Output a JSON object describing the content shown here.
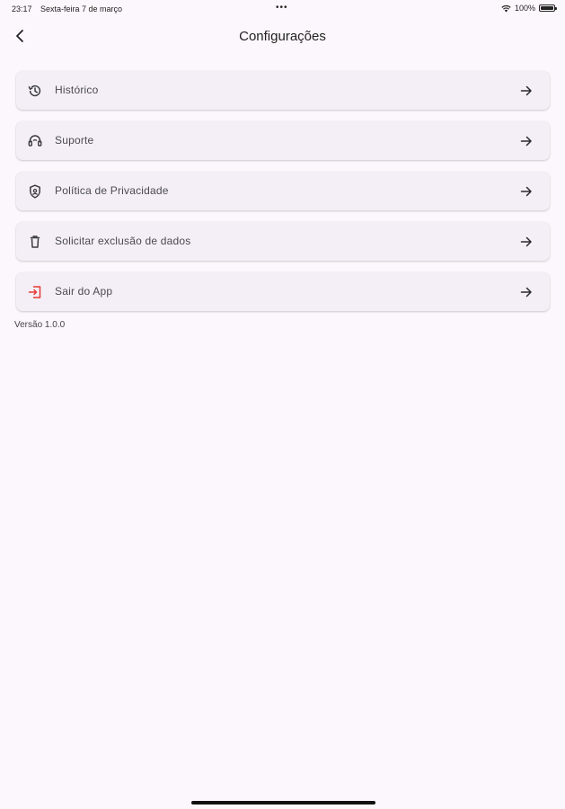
{
  "status_bar": {
    "time": "23:17",
    "date": "Sexta-feira 7 de março",
    "dots": "•••",
    "battery_text": "100%"
  },
  "header": {
    "back_icon": "chevron-left-icon",
    "title": "Configurações"
  },
  "menu": {
    "items": [
      {
        "label": "Histórico",
        "icon": "history-icon",
        "icon_color": "#3a3a3f"
      },
      {
        "label": "Suporte",
        "icon": "support-icon",
        "icon_color": "#3a3a3f"
      },
      {
        "label": "Política de Privacidade",
        "icon": "privacy-shield-icon",
        "icon_color": "#3a3a3f"
      },
      {
        "label": "Solicitar exclusão de dados",
        "icon": "trash-icon",
        "icon_color": "#3a3a3f"
      },
      {
        "label": "Sair do App",
        "icon": "logout-icon",
        "icon_color": "#e53935"
      }
    ],
    "arrow_icon": "arrow-right-icon"
  },
  "footer": {
    "version": "Versão 1.0.0"
  },
  "colors": {
    "background": "#fcf7fc",
    "card": "#f4eff6",
    "logout_accent": "#e53935"
  }
}
